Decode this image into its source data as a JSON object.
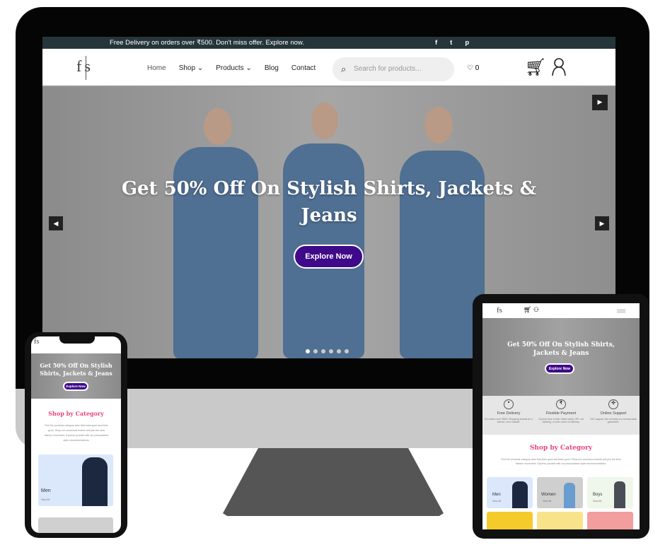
{
  "desktop": {
    "topbar": {
      "message": "Free Delivery on orders over ₹500. Don't miss offer. Explore now.",
      "social": [
        "f",
        "t",
        "p"
      ],
      "social_icons": [
        "facebook-icon",
        "twitter-icon",
        "pinterest-icon"
      ]
    },
    "logo": "fs",
    "nav": [
      {
        "label": "Home"
      },
      {
        "label": "Shop ⌄"
      },
      {
        "label": "Products ⌄"
      },
      {
        "label": "Blog"
      },
      {
        "label": "Contact"
      }
    ],
    "search_placeholder": "Search for products...",
    "wishlist_count": "♡ 0",
    "hero": {
      "title": "Get 50% Off On Stylish Shirts, Jackets & Jeans",
      "button": "Explore Now",
      "slides": 6,
      "active_slide": 1
    }
  },
  "tablet": {
    "hero_title": "Get 50% Off On Stylish Shirts, Jackets & Jeans",
    "button": "Explore Now",
    "features": [
      {
        "title": "Free Delivery",
        "desc": "Do orders over ₹500, Shopping should be a breeze, not a hassle."
      },
      {
        "title": "Flexible Payment",
        "desc": "Choose from credit / debit cards, UPI, net banking, or even cash on delivery."
      },
      {
        "title": "Online Support",
        "desc": "24/7 support, the security of a money-back guarantee."
      }
    ],
    "section_title": "Shop by Category",
    "section_desc": "Find the products category wise that feels good and feels good. Shop eco-conscious brands and join the slow fashion movement. Express yourself with our personalized style recommendations.",
    "categories": [
      {
        "name": "Men",
        "link": "View All"
      },
      {
        "name": "Women",
        "link": "View All"
      },
      {
        "name": "Boys",
        "link": "View All"
      }
    ]
  },
  "phone": {
    "hero_title": "Get 50% Off On Stylish Shirts, Jackets & Jeans",
    "button": "Explore Now",
    "section_title": "Shop by Category",
    "section_desc": "Find the products category wise that looks good and feels good. Shop eco-conscious brands and join the slow fashion movement. Express yourself with our personalized style recommendations.",
    "category": {
      "name": "Men",
      "link": "View All"
    }
  },
  "colors": {
    "accent": "#3f0a8a",
    "pink": "#e8457e",
    "topbar": "#26353a"
  }
}
